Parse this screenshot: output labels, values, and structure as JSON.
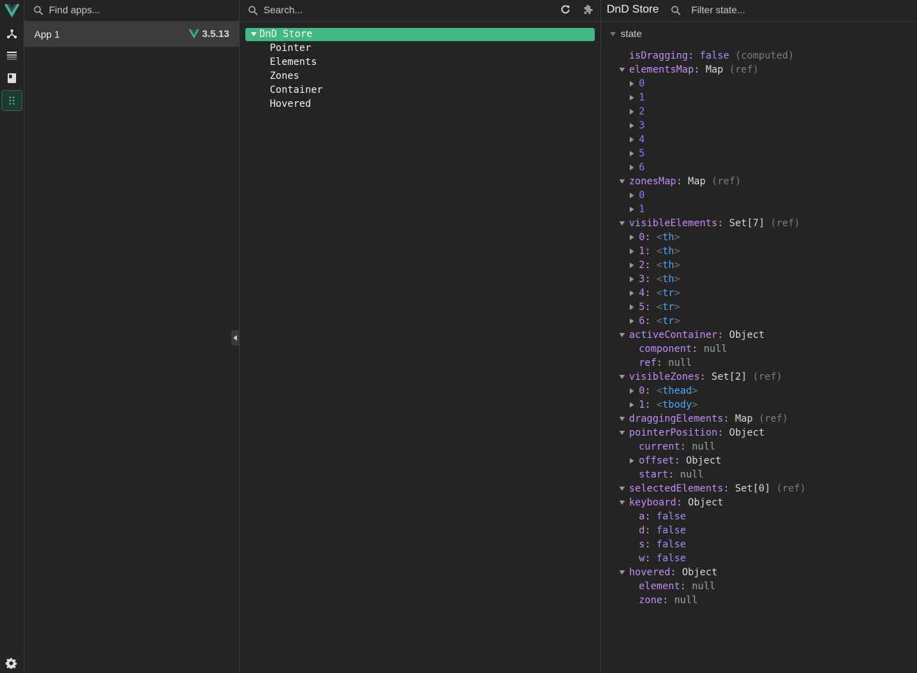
{
  "rail": {
    "icons": [
      "vue-logo-icon",
      "components-tree-icon",
      "timeline-icon",
      "pinia-icon",
      "plugin-grid-icon",
      "settings-icon"
    ],
    "accent": "#41b883"
  },
  "apps": {
    "search_placeholder": "Find apps...",
    "items": [
      {
        "name": "App 1",
        "version": "3.5.13"
      }
    ]
  },
  "tree": {
    "search_placeholder": "Search...",
    "selected": "DnD Store",
    "children": [
      "Pointer",
      "Elements",
      "Zones",
      "Container",
      "Hovered"
    ]
  },
  "inspector": {
    "title": "DnD Store",
    "filter_placeholder": "Filter state...",
    "section": "state",
    "rows": [
      {
        "d": 1,
        "tri": "none",
        "k": "isDragging",
        "sep": ": ",
        "v": "false",
        "vt": "f",
        "x": "(computed)"
      },
      {
        "d": 1,
        "tri": "down",
        "k": "elementsMap",
        "sep": ": ",
        "v": "Map",
        "vt": "v",
        "x": "(ref)"
      },
      {
        "d": 2,
        "tri": "right",
        "idx": "0"
      },
      {
        "d": 2,
        "tri": "right",
        "idx": "1"
      },
      {
        "d": 2,
        "tri": "right",
        "idx": "2"
      },
      {
        "d": 2,
        "tri": "right",
        "idx": "3"
      },
      {
        "d": 2,
        "tri": "right",
        "idx": "4"
      },
      {
        "d": 2,
        "tri": "right",
        "idx": "5"
      },
      {
        "d": 2,
        "tri": "right",
        "idx": "6"
      },
      {
        "d": 1,
        "tri": "down",
        "k": "zonesMap",
        "sep": ": ",
        "v": "Map",
        "vt": "v",
        "x": "(ref)"
      },
      {
        "d": 2,
        "tri": "right",
        "idx": "0"
      },
      {
        "d": 2,
        "tri": "right",
        "idx": "1"
      },
      {
        "d": 1,
        "tri": "down",
        "k": "visibleElements",
        "sep": ": ",
        "v": "Set[7]",
        "vt": "v",
        "x": "(ref)"
      },
      {
        "d": 2,
        "tri": "right",
        "k": "0",
        "sep": ": ",
        "tag": "th"
      },
      {
        "d": 2,
        "tri": "right",
        "k": "1",
        "sep": ": ",
        "tag": "th"
      },
      {
        "d": 2,
        "tri": "right",
        "k": "2",
        "sep": ": ",
        "tag": "th"
      },
      {
        "d": 2,
        "tri": "right",
        "k": "3",
        "sep": ": ",
        "tag": "th"
      },
      {
        "d": 2,
        "tri": "right",
        "k": "4",
        "sep": ": ",
        "tag": "tr"
      },
      {
        "d": 2,
        "tri": "right",
        "k": "5",
        "sep": ": ",
        "tag": "tr"
      },
      {
        "d": 2,
        "tri": "right",
        "k": "6",
        "sep": ": ",
        "tag": "tr"
      },
      {
        "d": 1,
        "tri": "down",
        "k": "activeContainer",
        "sep": ": ",
        "v": "Object",
        "vt": "v"
      },
      {
        "d": 2,
        "tri": "none",
        "k": "component",
        "sep": ": ",
        "v": "null",
        "vt": "n"
      },
      {
        "d": 2,
        "tri": "none",
        "k": "ref",
        "sep": ": ",
        "v": "null",
        "vt": "n"
      },
      {
        "d": 1,
        "tri": "down",
        "k": "visibleZones",
        "sep": ": ",
        "v": "Set[2]",
        "vt": "v",
        "x": "(ref)"
      },
      {
        "d": 2,
        "tri": "right",
        "k": "0",
        "sep": ": ",
        "tag": "thead"
      },
      {
        "d": 2,
        "tri": "right",
        "k": "1",
        "sep": ": ",
        "tag": "tbody"
      },
      {
        "d": 1,
        "tri": "down",
        "k": "draggingElements",
        "sep": ": ",
        "v": "Map",
        "vt": "v",
        "x": "(ref)"
      },
      {
        "d": 1,
        "tri": "down",
        "k": "pointerPosition",
        "sep": ": ",
        "v": "Object",
        "vt": "v"
      },
      {
        "d": 2,
        "tri": "none",
        "k": "current",
        "sep": ": ",
        "v": "null",
        "vt": "n"
      },
      {
        "d": 2,
        "tri": "right",
        "k": "offset",
        "sep": ": ",
        "v": "Object",
        "vt": "v"
      },
      {
        "d": 2,
        "tri": "none",
        "k": "start",
        "sep": ": ",
        "v": "null",
        "vt": "n"
      },
      {
        "d": 1,
        "tri": "down",
        "k": "selectedElements",
        "sep": ": ",
        "v": "Set[0]",
        "vt": "v",
        "x": "(ref)"
      },
      {
        "d": 1,
        "tri": "down",
        "k": "keyboard",
        "sep": ": ",
        "v": "Object",
        "vt": "v"
      },
      {
        "d": 2,
        "tri": "none",
        "k": "a",
        "sep": ": ",
        "v": "false",
        "vt": "f"
      },
      {
        "d": 2,
        "tri": "none",
        "k": "d",
        "sep": ": ",
        "v": "false",
        "vt": "f"
      },
      {
        "d": 2,
        "tri": "none",
        "k": "s",
        "sep": ": ",
        "v": "false",
        "vt": "f"
      },
      {
        "d": 2,
        "tri": "none",
        "k": "w",
        "sep": ": ",
        "v": "false",
        "vt": "f"
      },
      {
        "d": 1,
        "tri": "down",
        "k": "hovered",
        "sep": ": ",
        "v": "Object",
        "vt": "v"
      },
      {
        "d": 2,
        "tri": "none",
        "k": "element",
        "sep": ": ",
        "v": "null",
        "vt": "n"
      },
      {
        "d": 2,
        "tri": "none",
        "k": "zone",
        "sep": ": ",
        "v": "null",
        "vt": "n"
      }
    ]
  }
}
